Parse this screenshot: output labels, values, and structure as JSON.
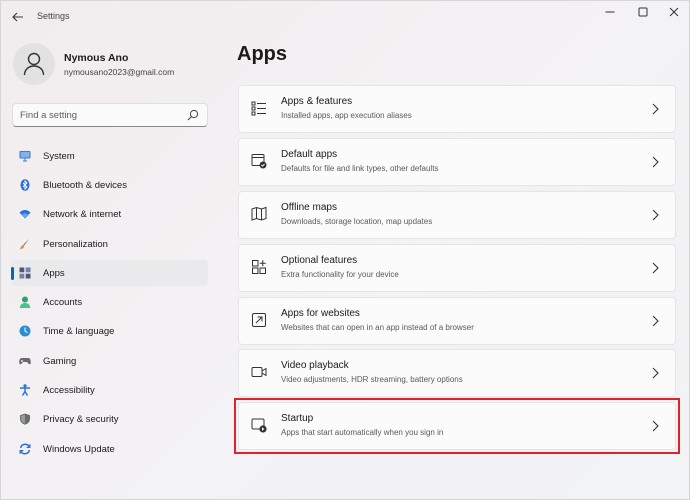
{
  "window": {
    "title": "Settings"
  },
  "account": {
    "name": "Nymous Ano",
    "email": "nymousano2023@gmail.com"
  },
  "search": {
    "placeholder": "Find a setting"
  },
  "sidebar": {
    "items": [
      {
        "label": "System",
        "icon": "monitor-icon",
        "color": "#3a7bd5"
      },
      {
        "label": "Bluetooth & devices",
        "icon": "bluetooth-icon",
        "color": "#2a6fdb"
      },
      {
        "label": "Network & internet",
        "icon": "wifi-icon",
        "color": "#2a6fdb"
      },
      {
        "label": "Personalization",
        "icon": "brush-icon",
        "color": "#c46a2a"
      },
      {
        "label": "Apps",
        "icon": "apps-icon",
        "color": "#4a5a78",
        "selected": true
      },
      {
        "label": "Accounts",
        "icon": "person-icon",
        "color": "#2ba36a"
      },
      {
        "label": "Time & language",
        "icon": "clock-globe-icon",
        "color": "#2a8fd0"
      },
      {
        "label": "Gaming",
        "icon": "gamepad-icon",
        "color": "#6b6b6b"
      },
      {
        "label": "Accessibility",
        "icon": "accessibility-icon",
        "color": "#2a6fdb"
      },
      {
        "label": "Privacy & security",
        "icon": "shield-icon",
        "color": "#6b6b6b"
      },
      {
        "label": "Windows Update",
        "icon": "update-icon",
        "color": "#2a6fdb"
      }
    ]
  },
  "main": {
    "title": "Apps",
    "cards": [
      {
        "title": "Apps & features",
        "desc": "Installed apps, app execution aliases",
        "icon": "list-icon"
      },
      {
        "title": "Default apps",
        "desc": "Defaults for file and link types, other defaults",
        "icon": "default-apps-icon"
      },
      {
        "title": "Offline maps",
        "desc": "Downloads, storage location, map updates",
        "icon": "map-icon"
      },
      {
        "title": "Optional features",
        "desc": "Extra functionality for your device",
        "icon": "add-grid-icon"
      },
      {
        "title": "Apps for websites",
        "desc": "Websites that can open in an app instead of a browser",
        "icon": "open-link-icon"
      },
      {
        "title": "Video playback",
        "desc": "Video adjustments, HDR streaming, battery options",
        "icon": "video-icon"
      },
      {
        "title": "Startup",
        "desc": "Apps that start automatically when you sign in",
        "icon": "startup-icon",
        "highlighted": true
      }
    ]
  },
  "colors": {
    "accent": "#0067c0",
    "highlight": "#e0232b"
  }
}
